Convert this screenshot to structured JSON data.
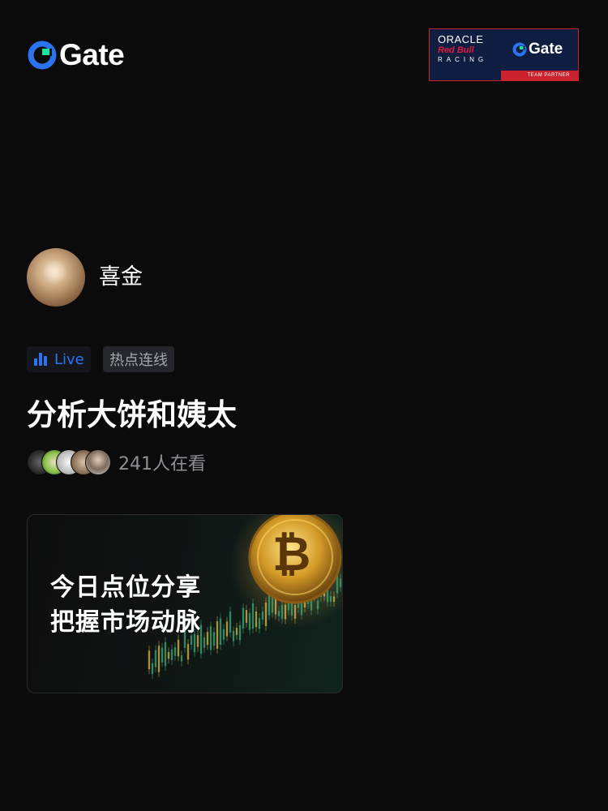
{
  "header": {
    "brand_text": "Gate",
    "partner": {
      "oracle": "ORACLE",
      "redbull": "Red Bull",
      "racing": "RACING",
      "gate_text": "Gate",
      "strip": "TEAM PARTNER"
    }
  },
  "host": {
    "name": "喜金",
    "avatar_icon": "host-avatar"
  },
  "tags": {
    "live": "Live",
    "topic": "热点连线"
  },
  "stream": {
    "title": "分析大饼和姨太",
    "viewers_text": "241人在看"
  },
  "card": {
    "line1": "今日点位分享",
    "line2": "把握市场动脉",
    "coin_symbol": "₿"
  },
  "colors": {
    "accent_blue": "#2d73f0",
    "brand_green": "#17e6a1",
    "partner_bg": "#0e1d40",
    "partner_red": "#c8232c",
    "background": "#0b0b0b"
  }
}
